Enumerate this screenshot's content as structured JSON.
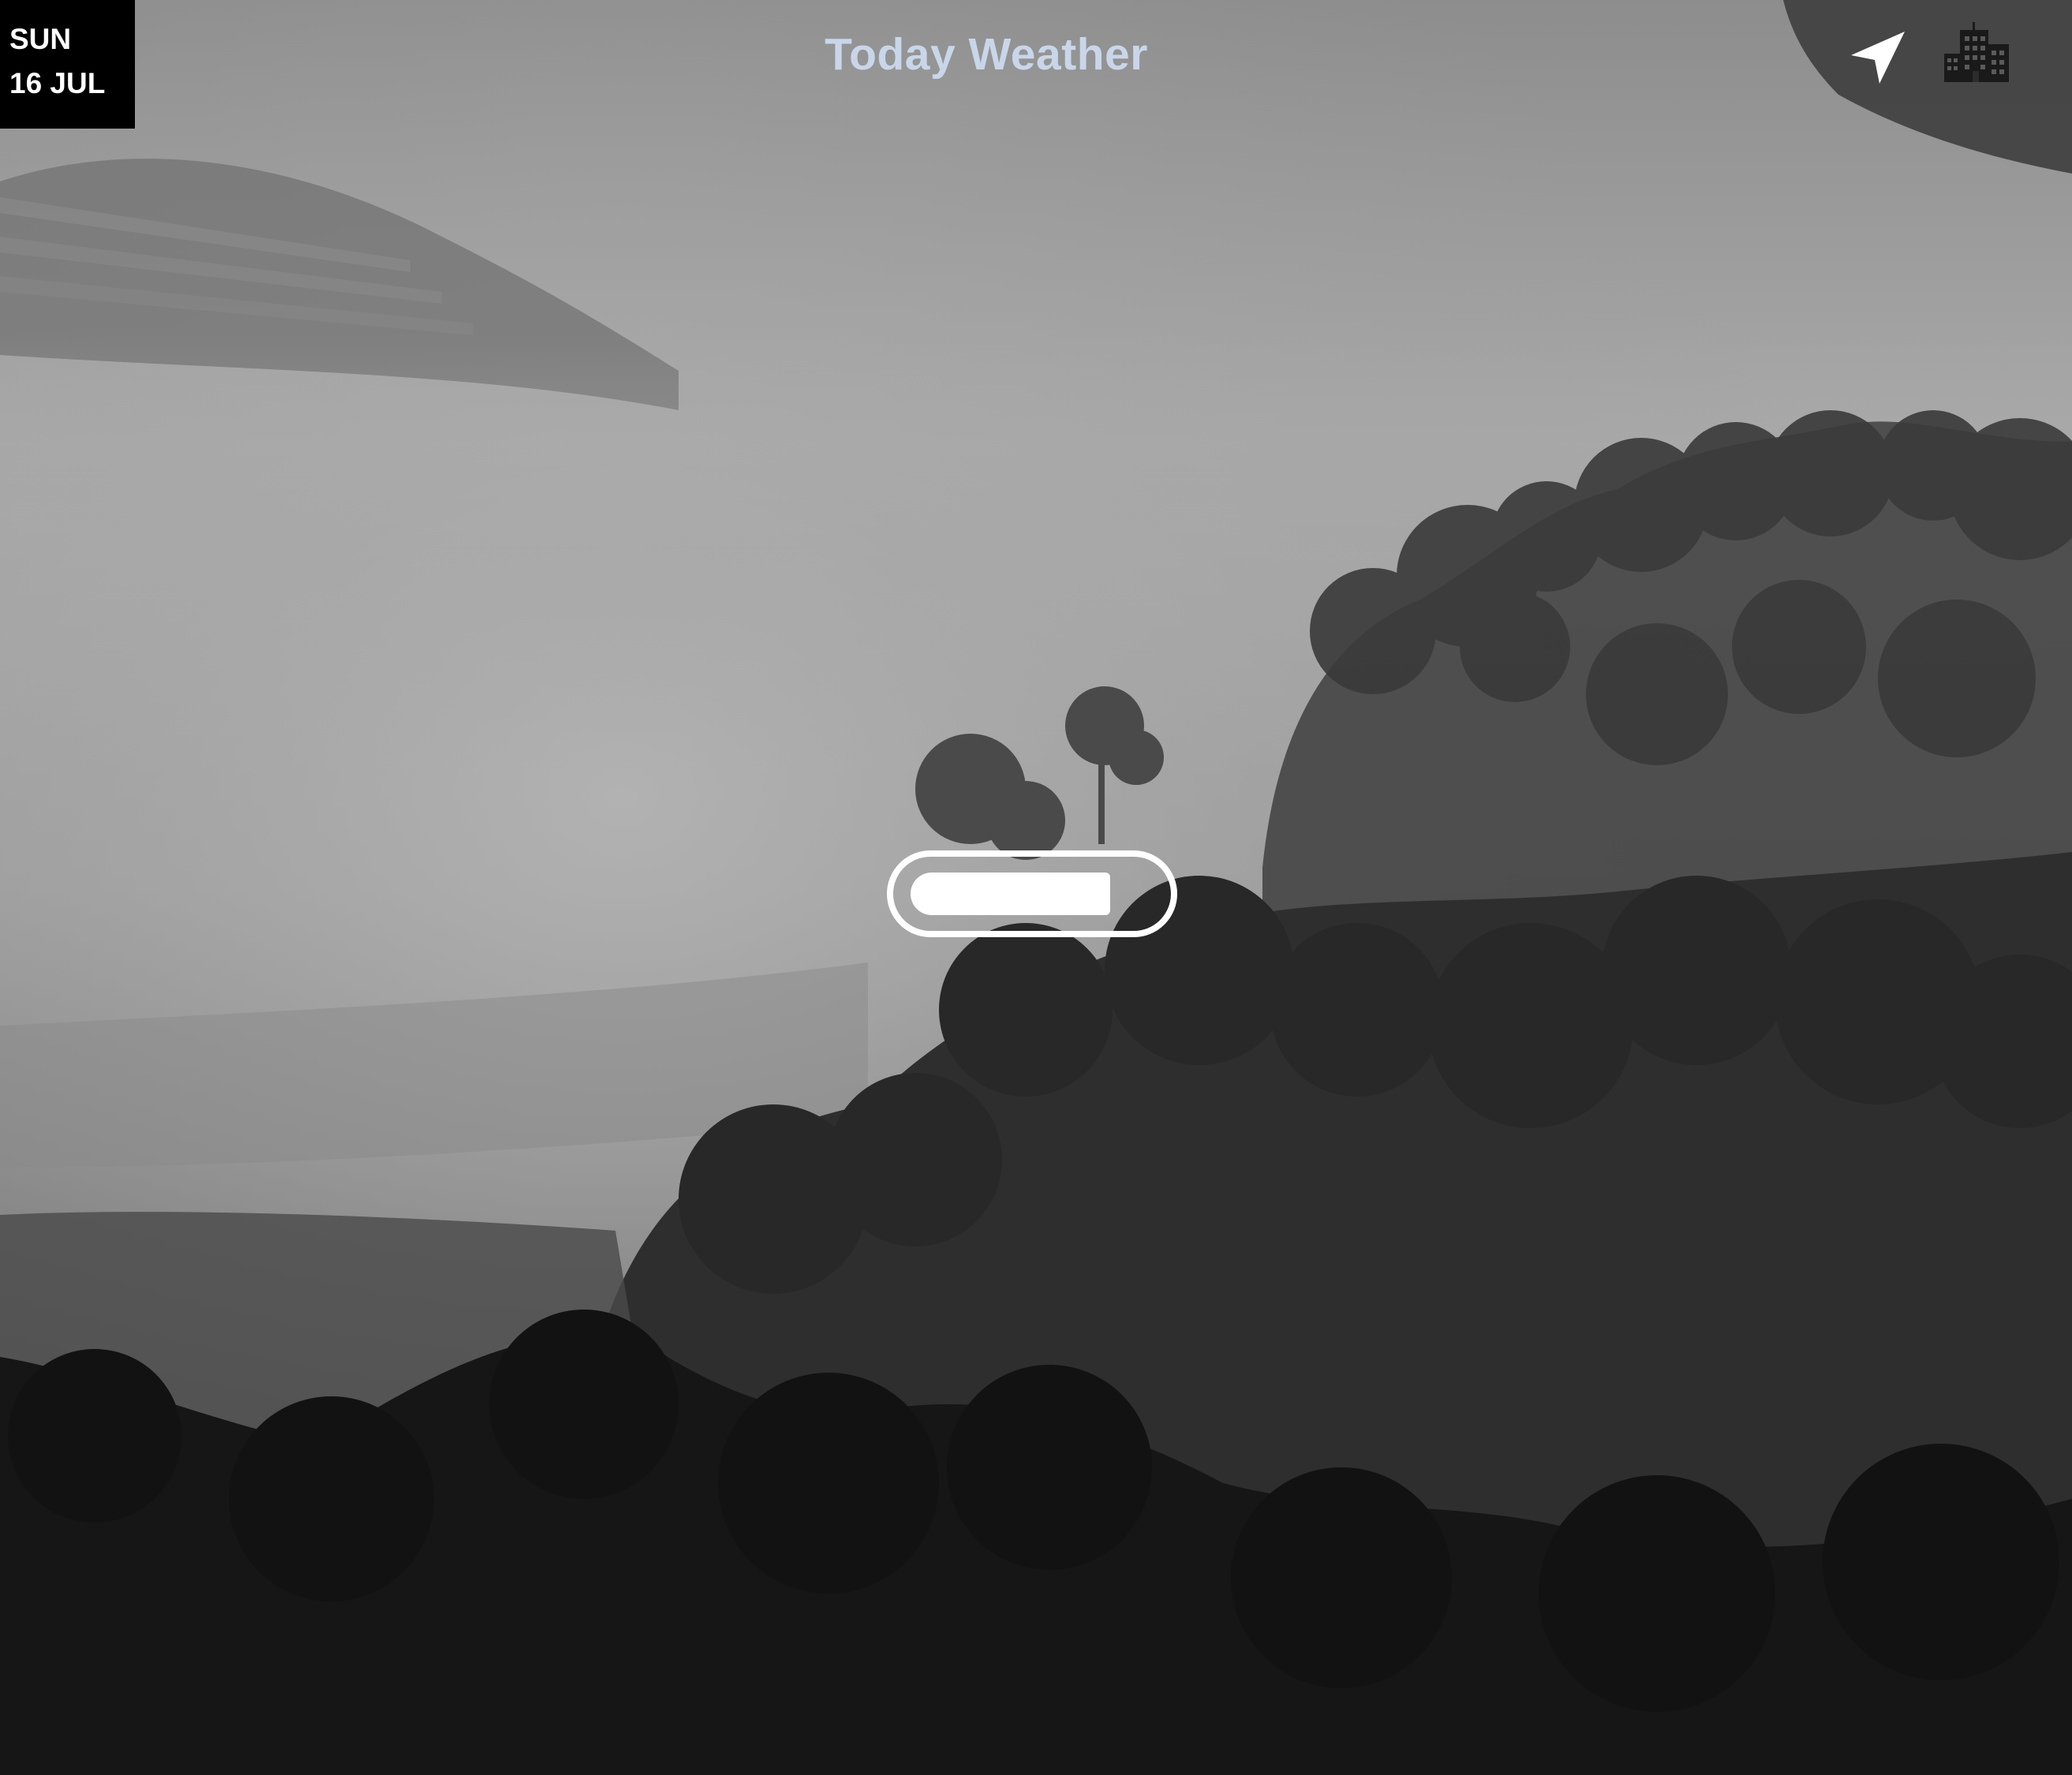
{
  "header": {
    "title": "Today Weather",
    "title_color": "#c9d6ea"
  },
  "date_badge": {
    "weekday": "SUN",
    "date": "16 JUL",
    "background": "#000000",
    "text_color": "#ffffff"
  },
  "toolbar": {
    "location_icon": "navigation-arrow-icon",
    "city_icon": "city-buildings-icon"
  },
  "loader": {
    "progress": 0.82,
    "color": "#ffffff"
  },
  "background": {
    "description_icon": "foggy-forest-background",
    "tone": "grayscale"
  }
}
